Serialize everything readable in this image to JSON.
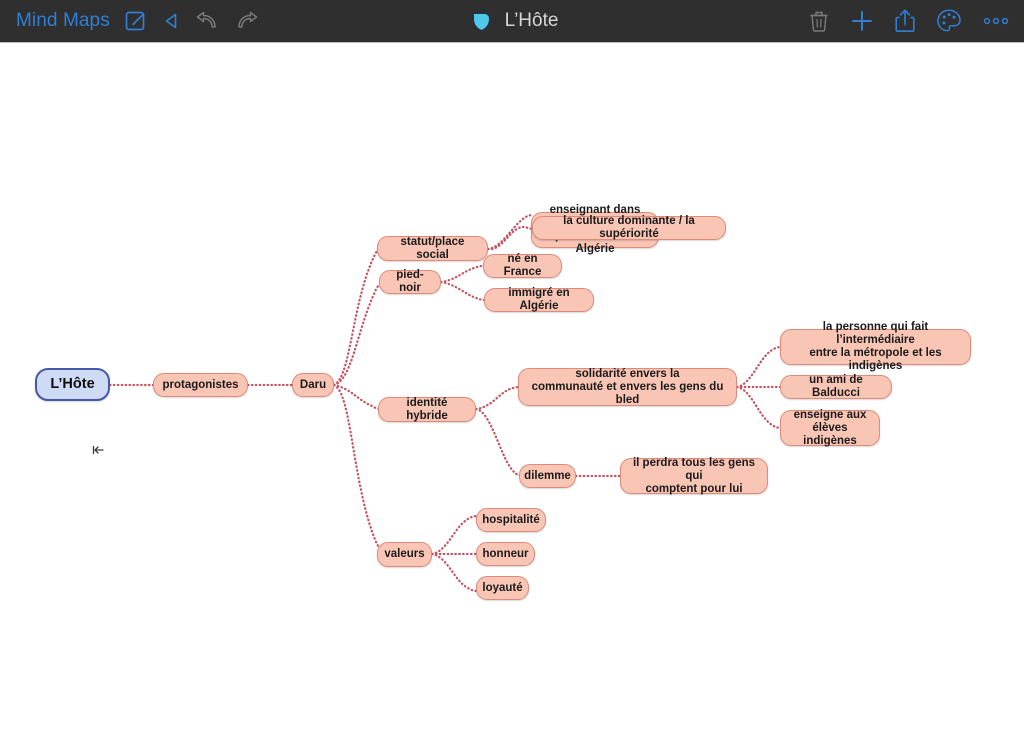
{
  "toolbar": {
    "back_label": "Mind Maps",
    "compose_icon": "compose-icon",
    "back_icon": "back-triangle-icon",
    "undo_icon": "undo-icon",
    "redo_icon": "redo-icon",
    "document_title": "L’Hôte",
    "app_icon": "app-shield-icon",
    "trash_icon": "trash-icon",
    "add_icon": "plus-icon",
    "share_icon": "share-icon",
    "palette_icon": "palette-icon",
    "more_icon": "more-dots-icon",
    "colors": {
      "bar_background": "#2f2f2f",
      "accent_blue": "#2f7fd4",
      "disabled_gray": "#7a7a7a",
      "title_text": "#d6d6d6"
    }
  },
  "canvas": {
    "background": "#ffffff",
    "node_fill": "#f9c5b5",
    "node_border": "#de8b79",
    "root_fill": "#cfdaf5",
    "root_border": "#4558a8",
    "link_color": "#c4525f",
    "collapse_handle_glyph": "←|"
  },
  "mindmap": {
    "root": {
      "label": "L’Hôte"
    },
    "nodes": [
      {
        "id": "root",
        "label": "L’Hôte"
      },
      {
        "id": "protagonistes",
        "label": "protagonistes"
      },
      {
        "id": "daru",
        "label": "Daru"
      },
      {
        "id": "statut",
        "label": "statut/place social"
      },
      {
        "id": "enseignant",
        "label": "enseignant dans une\npetite école en Algérie"
      },
      {
        "id": "culture",
        "label": "la culture dominante / la supériorité"
      },
      {
        "id": "piednoir",
        "label": "pied-noir"
      },
      {
        "id": "nefrance",
        "label": "né en France"
      },
      {
        "id": "immigre",
        "label": "immigré en Algérie"
      },
      {
        "id": "identite",
        "label": "identité hybride"
      },
      {
        "id": "solidarite",
        "label": "solidarité envers la\ncommunauté et envers les gens du bled"
      },
      {
        "id": "intermediaire",
        "label": "la personne qui fait l’intermédiaire\nentre la métropole et les indigènes"
      },
      {
        "id": "balducci",
        "label": "un ami de Balducci"
      },
      {
        "id": "enseigne",
        "label": "enseigne aux\nélèves indigènes"
      },
      {
        "id": "dilemme",
        "label": "dilemme"
      },
      {
        "id": "perdra",
        "label": "il perdra tous les gens qui\ncomptent pour lui"
      },
      {
        "id": "valeurs",
        "label": "valeurs"
      },
      {
        "id": "hospitalite",
        "label": "hospitalité"
      },
      {
        "id": "honneur",
        "label": "honneur"
      },
      {
        "id": "loyaute",
        "label": "loyauté"
      }
    ]
  }
}
